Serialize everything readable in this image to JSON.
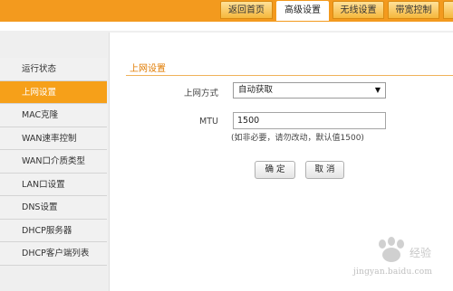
{
  "header": {
    "tabs": [
      "返回首页",
      "高级设置",
      "无线设置",
      "带宽控制"
    ],
    "active_tab": 1,
    "accent": "#f39a1e"
  },
  "sidebar": {
    "items": [
      {
        "label": "运行状态"
      },
      {
        "label": "上网设置"
      },
      {
        "label": "MAC克隆"
      },
      {
        "label": "WAN速率控制"
      },
      {
        "label": "WAN口介质类型"
      },
      {
        "label": "LAN口设置"
      },
      {
        "label": "DNS设置"
      },
      {
        "label": "DHCP服务器"
      },
      {
        "label": "DHCP客户端列表"
      }
    ],
    "active_index": 1,
    "active_color": "#f6a019"
  },
  "main": {
    "section_title": "上网设置",
    "mode_label": "上网方式",
    "mode_value": "自动获取",
    "mtu_label": "MTU",
    "mtu_value": "1500",
    "mtu_hint": "(如非必要，请勿改动，默认值1500)",
    "ok_label": "确 定",
    "cancel_label": "取 消"
  },
  "watermark": {
    "text": "jingyan.baidu.com"
  },
  "icons": {
    "dropdown": "chevron-down-icon"
  }
}
